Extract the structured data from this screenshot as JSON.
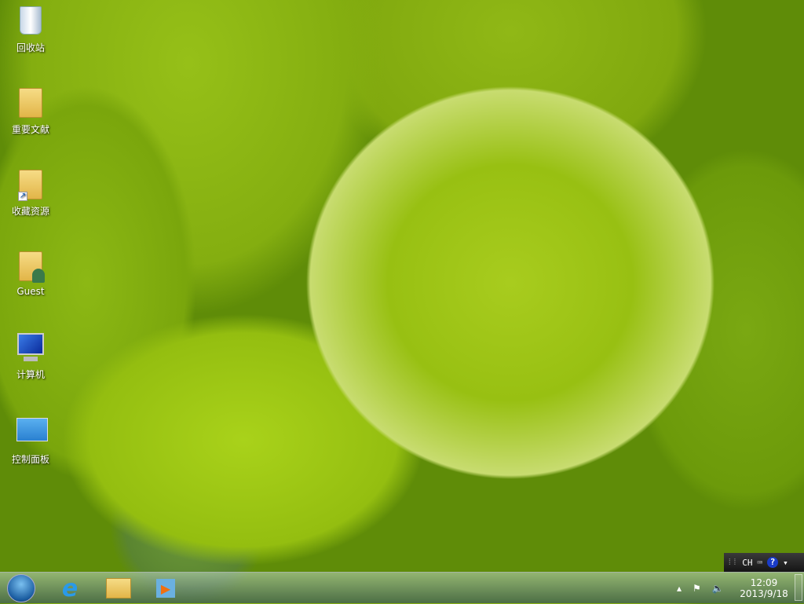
{
  "desktop_icons": [
    {
      "label": "回收站",
      "icon": "recycle-bin-icon"
    },
    {
      "label": "重要文献",
      "icon": "folder-icon"
    },
    {
      "label": "收藏资源",
      "icon": "folder-shortcut-icon"
    },
    {
      "label": "Guest",
      "icon": "user-folder-icon"
    },
    {
      "label": "计算机",
      "icon": "computer-icon"
    },
    {
      "label": "控制面板",
      "icon": "control-panel-icon"
    }
  ],
  "language_bar": {
    "language": "CH"
  },
  "clock": {
    "time": "12:09",
    "date": "2013/9/18"
  }
}
